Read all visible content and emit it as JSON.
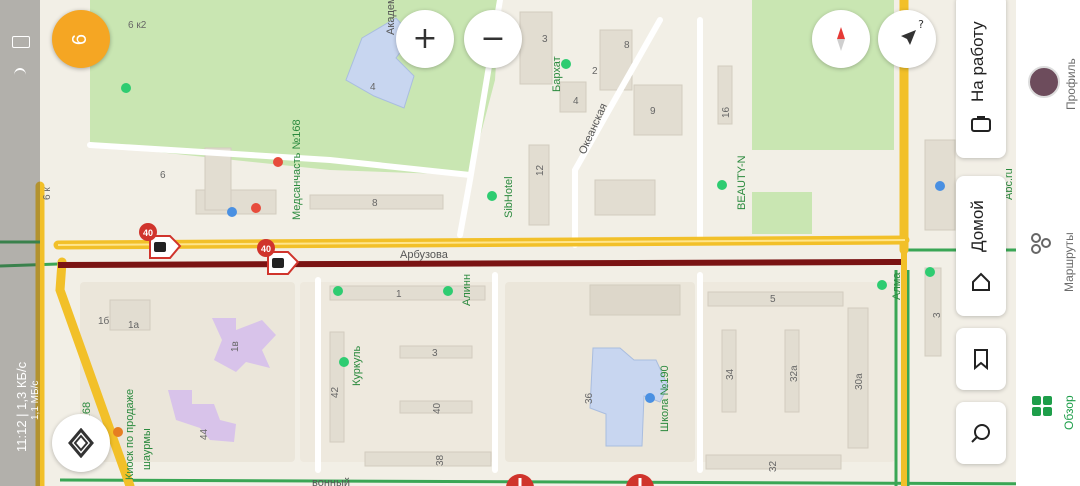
{
  "map": {
    "streets": {
      "main": "Арбузова",
      "okeanskaya": "Океанская",
      "akadem": "Академ",
      "bottom": "вонный"
    },
    "buildings": [
      "6 к2",
      "3",
      "8",
      "2",
      "4",
      "4",
      "9",
      "16",
      "12",
      "6",
      "8",
      "6 к",
      "1",
      "5",
      "1б",
      "1а",
      "1в",
      "3",
      "42",
      "40",
      "34",
      "32а",
      "30а",
      "36",
      "44",
      "38",
      "32",
      "3",
      "168"
    ],
    "pois": {
      "medsanchast": "Медсанчасть №168",
      "barkhat": "Бархат",
      "sibhotel": "SibHotel",
      "beauty": "BEAUTY-N",
      "abc": "Abc.ru",
      "alinn": "Алинн",
      "kurkul": "Куркуль",
      "school": "Школа №190",
      "kiosk_line1": "Киоск по продаже",
      "kiosk_line2": "шаурмы",
      "bottom_poi": "№168",
      "alma": "Алма"
    },
    "speed_cameras": [
      "40",
      "40"
    ],
    "scale_notes": "",
    "colors": {
      "road_yellow": "#f2c029",
      "road_dark": "#7a1313",
      "park": "#c9e6b2",
      "water": "#cce0f0"
    }
  },
  "status_bar": {
    "time_speed": "11:12 | 1,3 КБ/с",
    "extra": "1,1 МБ/с"
  },
  "controls": {
    "badge_count": "6",
    "zoom_in": "+",
    "zoom_out": "−",
    "route_icon": "navigation-icon",
    "help_hint": "?"
  },
  "favorites": {
    "work": "На работу",
    "home": "Домой"
  },
  "nav": {
    "profile": "Профиль",
    "routes": "Маршруты",
    "overview": "Обзор"
  }
}
